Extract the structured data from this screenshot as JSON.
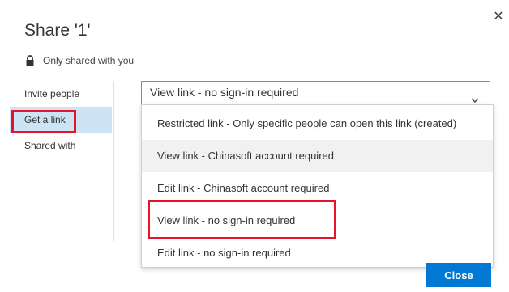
{
  "dialog": {
    "title": "Share '1'",
    "close_icon": "close-icon",
    "sharing_status": {
      "icon": "lock-icon",
      "text": "Only shared with you"
    }
  },
  "nav": {
    "items": [
      {
        "label": "Invite people",
        "selected": false
      },
      {
        "label": "Get a link",
        "selected": true
      },
      {
        "label": "Shared with",
        "selected": false
      }
    ]
  },
  "link_type_select": {
    "value": "View link - no sign-in required",
    "icon": "chevron-down-icon",
    "options": [
      {
        "label": "Restricted link - Only specific people can open this link (created)"
      },
      {
        "label": "View link - Chinasoft account required"
      },
      {
        "label": "Edit link - Chinasoft account required"
      },
      {
        "label": "View link - no sign-in required"
      },
      {
        "label": "Edit link - no sign-in required"
      }
    ],
    "hovered_option": "View link - Chinasoft account required",
    "annotated_option": "View link - no sign-in required"
  },
  "footer": {
    "close_label": "Close"
  },
  "colors": {
    "accent": "#0078d4",
    "nav_selected": "#cde4f5",
    "annotation": "#e8132b"
  }
}
